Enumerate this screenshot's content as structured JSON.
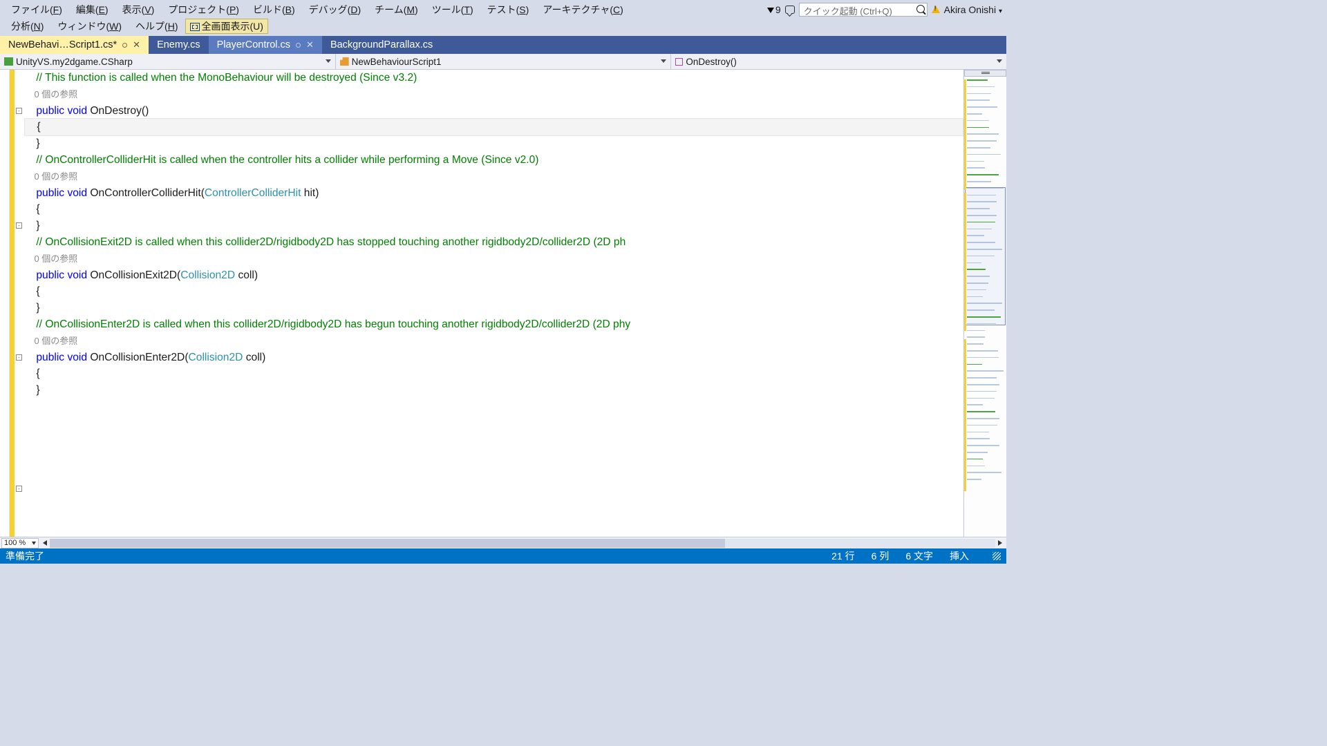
{
  "menu": {
    "row1": [
      "ファイル(F)",
      "編集(E)",
      "表示(V)",
      "プロジェクト(P)",
      "ビルド(B)",
      "デバッグ(D)",
      "チーム(M)",
      "ツール(T)",
      "テスト(S)",
      "アーキテクチャ(C)"
    ],
    "row2": [
      "分析(N)",
      "ウィンドウ(W)",
      "ヘルプ(H)"
    ],
    "fullscreen": "全画面表示(U)",
    "notif_count": "9",
    "quicklaunch_placeholder": "クイック起動 (Ctrl+Q)",
    "user": "Akira Onishi"
  },
  "tabs": [
    {
      "label": "NewBehavi…Script1.cs*",
      "active": true,
      "pinned": true,
      "closable": true
    },
    {
      "label": "Enemy.cs",
      "active": false
    },
    {
      "label": "PlayerControl.cs",
      "active": false,
      "sel": true,
      "pinned": true,
      "closable": true
    },
    {
      "label": "BackgroundParallax.cs",
      "active": false
    }
  ],
  "nav": {
    "project": "UnityVS.my2dgame.CSharp",
    "class": "NewBehaviourScript1",
    "member": "OnDestroy()"
  },
  "code": {
    "ref": "0 個の参照",
    "lines": [
      {
        "t": "cm",
        "txt": "    // This function is called when the MonoBehaviour will be destroyed (Since v3.2)"
      },
      {
        "t": "ref",
        "txt": "    0 個の参照"
      },
      {
        "t": "sig",
        "kw1": "public",
        "kw2": "void",
        "name": " OnDestroy()",
        "fold": true
      },
      {
        "t": "plain",
        "txt": "    {",
        "hl": true
      },
      {
        "t": "plain",
        "txt": ""
      },
      {
        "t": "plain",
        "txt": "    }"
      },
      {
        "t": "plain",
        "txt": ""
      },
      {
        "t": "cm",
        "txt": "    // OnControllerColliderHit is called when the controller hits a collider while performing a Move (Since v2.0)"
      },
      {
        "t": "ref",
        "txt": "    0 個の参照"
      },
      {
        "t": "sig",
        "kw1": "public",
        "kw2": "void",
        "name": " OnControllerColliderHit(",
        "type": "ControllerColliderHit",
        "rest": " hit)",
        "fold": true
      },
      {
        "t": "plain",
        "txt": "    {"
      },
      {
        "t": "plain",
        "txt": ""
      },
      {
        "t": "plain",
        "txt": ""
      },
      {
        "t": "plain",
        "txt": "    }"
      },
      {
        "t": "plain",
        "txt": ""
      },
      {
        "t": "cm",
        "txt": "    // OnCollisionExit2D is called when this collider2D/rigidbody2D has stopped touching another rigidbody2D/collider2D (2D ph"
      },
      {
        "t": "ref",
        "txt": "    0 個の参照"
      },
      {
        "t": "sig",
        "kw1": "public",
        "kw2": "void",
        "name": " OnCollisionExit2D(",
        "type": "Collision2D",
        "rest": " coll)",
        "fold": true
      },
      {
        "t": "plain",
        "txt": "    {"
      },
      {
        "t": "plain",
        "txt": ""
      },
      {
        "t": "plain",
        "txt": ""
      },
      {
        "t": "plain",
        "txt": "    }"
      },
      {
        "t": "plain",
        "txt": ""
      },
      {
        "t": "cm",
        "txt": "    // OnCollisionEnter2D is called when this collider2D/rigidbody2D has begun touching another rigidbody2D/collider2D (2D phy"
      },
      {
        "t": "ref",
        "txt": "    0 個の参照"
      },
      {
        "t": "sig",
        "kw1": "public",
        "kw2": "void",
        "name": " OnCollisionEnter2D(",
        "type": "Collision2D",
        "rest": " coll)",
        "fold": true
      },
      {
        "t": "plain",
        "txt": "    {"
      },
      {
        "t": "plain",
        "txt": ""
      },
      {
        "t": "plain",
        "txt": "    }"
      }
    ]
  },
  "zoom": "100 %",
  "status": {
    "ready": "準備完了",
    "line": "21 行",
    "col": "6 列",
    "chars": "6 文字",
    "ins": "挿入"
  }
}
